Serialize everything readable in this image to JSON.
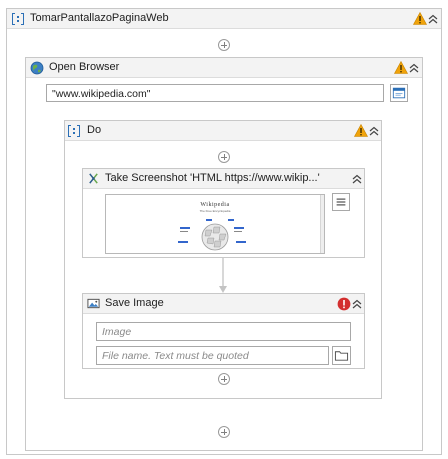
{
  "root_sequence": {
    "title": "TomarPantallazoPaginaWeb"
  },
  "open_browser": {
    "title": "Open Browser",
    "url_value": "\"www.wikipedia.com\""
  },
  "do_block": {
    "title": "Do"
  },
  "take_screenshot": {
    "title": "Take Screenshot 'HTML  https://www.wikip...'",
    "preview_logo_text": "Wikipedia",
    "preview_tagline": "The Free Encyclopedia"
  },
  "save_image": {
    "title": "Save Image",
    "image_placeholder": "Image",
    "filename_placeholder": "File name. Text must be quoted"
  },
  "colors": {
    "warning": "#f0a30a",
    "error": "#d32f2f",
    "accent": "#2b6fb6"
  },
  "icons": [
    "sequence-icon",
    "warning-icon",
    "collapse-icon",
    "add-activity-icon",
    "globe-icon",
    "browser-icon",
    "camera-icon",
    "menu-icon",
    "image-icon",
    "error-icon",
    "folder-icon"
  ]
}
